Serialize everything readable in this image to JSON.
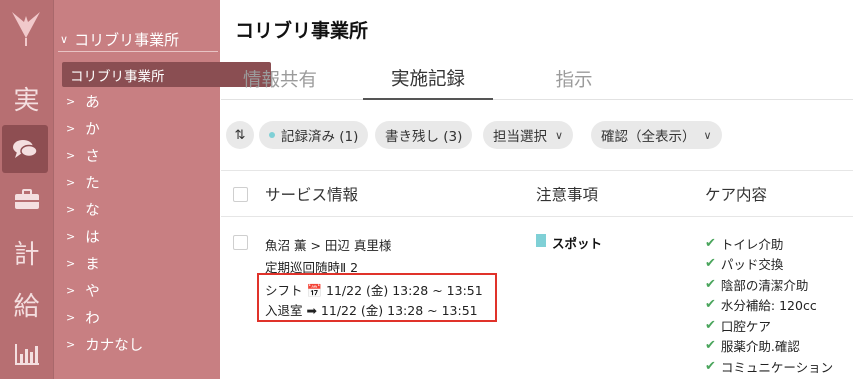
{
  "rail": {
    "items": [
      "実",
      "計",
      "給"
    ],
    "accent": "#b76f72",
    "active_bg": "#8e4e52",
    "icons": [
      "logo-icon",
      "chat-icon",
      "briefcase-icon",
      "bar-chart-icon"
    ]
  },
  "sidebar": {
    "header": "コリブリ事業所",
    "selected": "コリブリ事業所",
    "items": [
      "あ",
      "か",
      "さ",
      "た",
      "な",
      "は",
      "ま",
      "や",
      "わ",
      "カナなし"
    ]
  },
  "main": {
    "title": "コリブリ事業所",
    "tabs": [
      {
        "label": "情報共有"
      },
      {
        "label": "実施記録"
      },
      {
        "label": "指示"
      }
    ],
    "active_tab": "実施記録",
    "filters": {
      "sort_icon": "sort-icon",
      "recorded": "記録済み (1)",
      "unfinished": "書き残し (3)",
      "assignee": "担当選択",
      "confirm": "確認（全表示）"
    },
    "table": {
      "headers": {
        "service": "サービス情報",
        "notes": "注意事項",
        "care": "ケア内容"
      },
      "row": {
        "people": "魚沼 薫 > 田辺 真里様",
        "service_type": "定期巡回随時Ⅱ 2",
        "shift": "シフト 📅 11/22 (金) 13:28 ~ 13:51",
        "entry_exit": "入退室 ➡ 11/22 (金) 13:28 ~ 13:51",
        "note_label": "スポット",
        "note_color": "#7fd0d6",
        "care_items": [
          "トイレ介助",
          "パッド交換",
          "陰部の清潔介助",
          "水分補給: 120cc",
          "口腔ケア",
          "服薬介助.確認",
          "コミュニケーション"
        ],
        "highlight_color": "#e0322a",
        "check_color": "#4aa55c"
      }
    }
  }
}
